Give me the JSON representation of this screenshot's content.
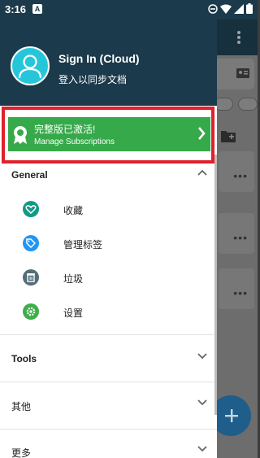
{
  "status_bar": {
    "time": "3:16"
  },
  "profile": {
    "name": "Sign In (Cloud)",
    "subtitle": "登入以同步文档"
  },
  "premium": {
    "title": "完整版已激活!",
    "subtitle": "Manage Subscriptions"
  },
  "sections": {
    "general": "General",
    "tools": "Tools",
    "other": "其他",
    "more": "更多"
  },
  "menu": {
    "favorites": {
      "label": "收藏",
      "color": "#139a86"
    },
    "tags": {
      "label": "管理标签",
      "color": "#2196f3"
    },
    "trash": {
      "label": "垃圾",
      "color": "#546e7a"
    },
    "settings": {
      "label": "设置",
      "color": "#3fae4a"
    }
  },
  "colors": {
    "header": "#1b3a4b",
    "premium": "#36a94a",
    "highlight": "#e0202c"
  }
}
